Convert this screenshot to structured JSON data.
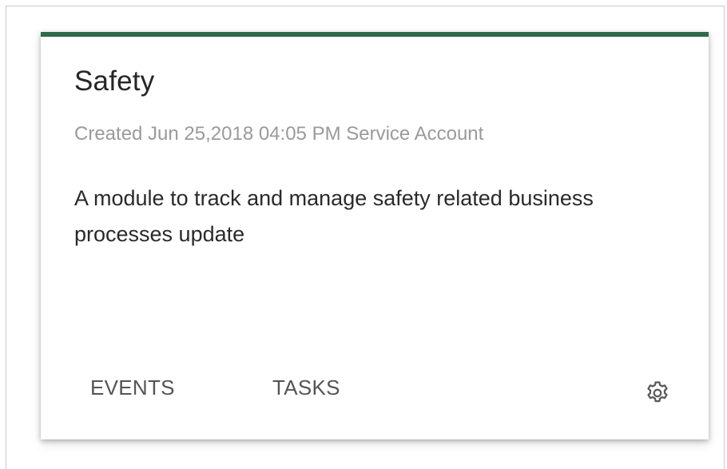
{
  "card": {
    "accent_color": "#2e6b4a",
    "title": "Safety",
    "meta": "Created Jun 25,2018 04:05 PM Service Account",
    "description": "A module to track and manage safety related business processes update",
    "actions": {
      "events_label": "EVENTS",
      "tasks_label": "TASKS",
      "settings_icon": "gear-icon"
    }
  }
}
